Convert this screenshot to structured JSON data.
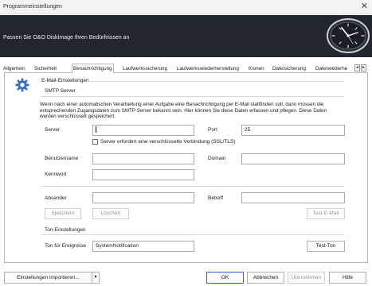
{
  "window": {
    "title": "Programmeinstellungen",
    "close_glyph": "✕"
  },
  "banner": {
    "text": "Passen Sie O&O DiskImage Ihren Bedürfnissen an",
    "icon": "clock-logo"
  },
  "tabs": [
    {
      "label": "Allgemein"
    },
    {
      "label": "Sicherheit"
    },
    {
      "label": "Benachrichtigung",
      "active": true
    },
    {
      "label": "Laufwerkssicherung"
    },
    {
      "label": "Laufwerkswiederherstellung"
    },
    {
      "label": "Klonen"
    },
    {
      "label": "Dateisicherung"
    },
    {
      "label": "Dateiwiederhe"
    }
  ],
  "tab_scroll": {
    "left": "◄",
    "right": "►"
  },
  "email": {
    "section_title": "E-Mail-Einstellungen",
    "smtp_title": "SMTP Server",
    "description": "Wenn nach einer automatischen Verarbeitung einer Aufgabe eine Benachrichtigung per E-Mail stattfinden soll, dann müssen die entsprechenden Zugangsdaten zum SMTP Server bekannt sein. Hier können Sie diese Daten erfassen und pflegen. Diese Daten werden verschlüsselt gespeichert.",
    "server_label": "Server",
    "server_value": "",
    "port_label": "Port",
    "port_value": "25",
    "ssl_label": "Server erfordert eine verschlüsselte Verbindung (SSL/TLS)",
    "ssl_checked": false,
    "username_label": "Benutzername",
    "username_value": "",
    "domain_label": "Domain",
    "domain_value": "",
    "password_label": "Kennwort",
    "password_value": "",
    "sender_label": "Absender",
    "sender_value": "",
    "subject_label": "Betreff",
    "subject_value": "",
    "save_button": "Speichern",
    "delete_button": "Löschen",
    "test_email_button": "Test-E-Mail"
  },
  "sound": {
    "section_title": "Ton-Einstellungen",
    "events_label": "Ton für Ereignisse",
    "events_value": "SystemNotification",
    "test_sound_button": "Test-Ton"
  },
  "footer": {
    "import_button": "Einstellungen importieren...",
    "import_arrow": "▾",
    "ok_button": "OK",
    "cancel_button": "Abbrechen",
    "apply_button": "Übernehmen",
    "help_button": "Hilfe"
  }
}
